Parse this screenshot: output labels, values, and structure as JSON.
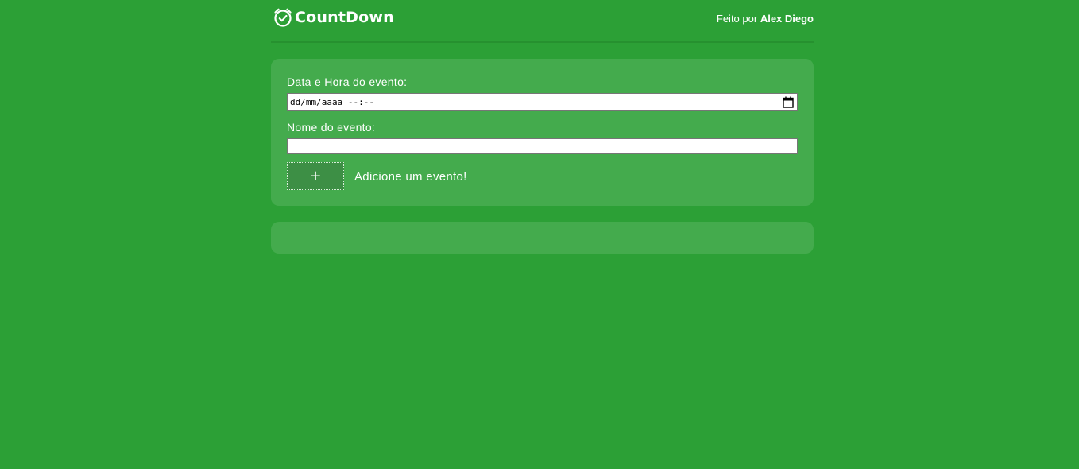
{
  "header": {
    "app_name": "CountDown",
    "logo_icon": "alarm-clock-check-icon",
    "credit_prefix": "Feito por ",
    "credit_author": "Alex Diego"
  },
  "form": {
    "date_label": "Data e Hora do evento:",
    "date_value": "dd/mm/aaaa --:--",
    "date_icon": "calendar-icon",
    "name_label": "Nome do evento:",
    "name_value": "",
    "add_button_label": "+",
    "add_hint": "Adicione um evento!"
  },
  "events": {
    "items": []
  },
  "colors": {
    "background": "#2ca036",
    "card": "#44ab4d",
    "button": "#3d8f45",
    "text": "#ffffff"
  }
}
